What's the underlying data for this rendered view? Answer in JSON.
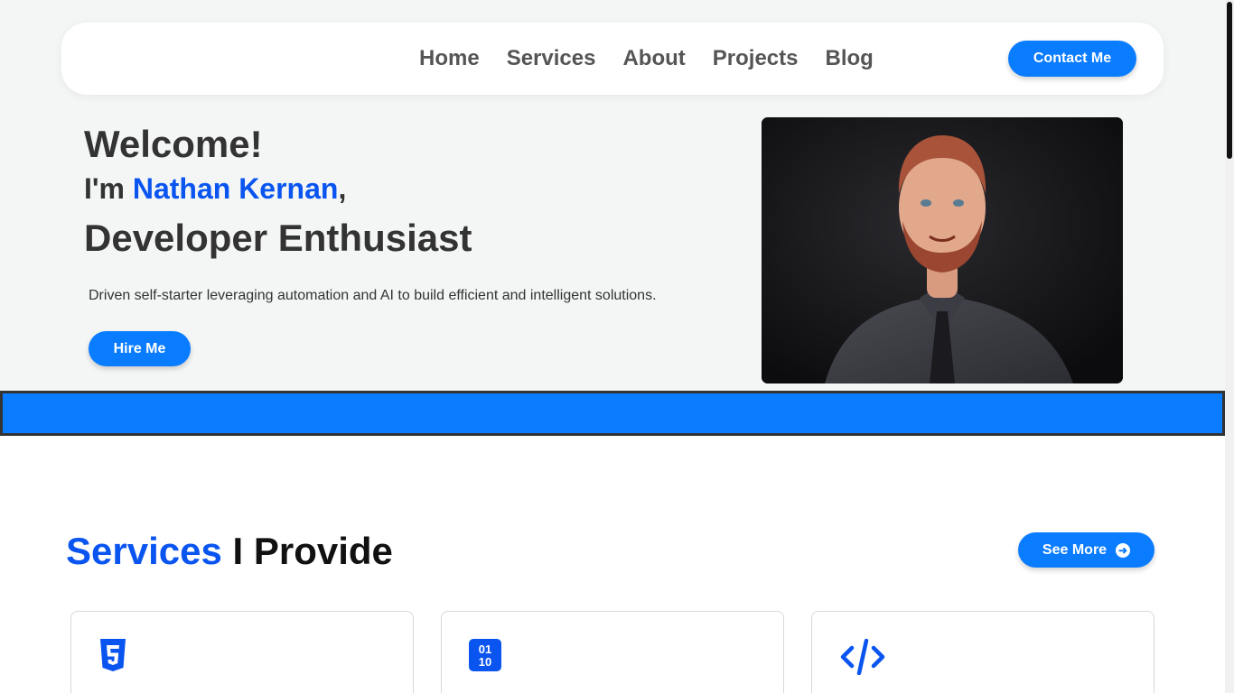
{
  "nav": {
    "links": [
      "Home",
      "Services",
      "About",
      "Projects",
      "Blog"
    ],
    "contact_label": "Contact Me"
  },
  "hero": {
    "welcome": "Welcome!",
    "im_prefix": "I'm ",
    "name": "Nathan Kernan",
    "name_suffix": ",",
    "role": "Developer Enthusiast",
    "tagline": "Driven self-starter leveraging automation and AI to build efficient and intelligent solutions.",
    "hire_label": "Hire Me"
  },
  "services": {
    "title_accent": "Services",
    "title_rest": " I Provide",
    "see_more_label": "See More",
    "cards": [
      {
        "icon": "html5-icon"
      },
      {
        "icon": "binary-icon"
      },
      {
        "icon": "code-icon"
      }
    ]
  },
  "colors": {
    "accent_blue": "#0a7cff",
    "name_blue": "#0a55f0",
    "hero_bg": "#f4f6f6"
  }
}
